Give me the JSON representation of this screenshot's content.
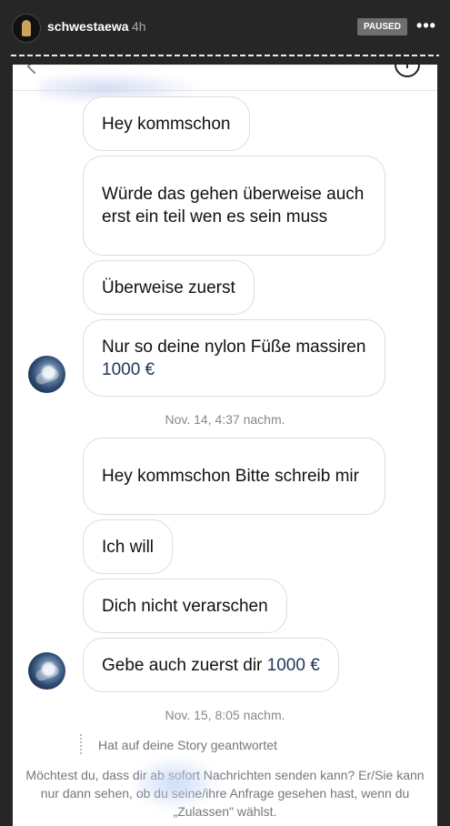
{
  "header": {
    "username": "schwestaewa",
    "time_ago": "4h",
    "paused_label": "PAUSED",
    "more_icon": "more-dots-icon"
  },
  "chat": {
    "messages": [
      {
        "text": "Hey kommschon"
      },
      {
        "text": "Würde das gehen überweise auch erst ein teil wen es sein muss"
      },
      {
        "text": "Überweise zuerst"
      },
      {
        "text_before": "Nur so deine nylon  Füße massiren ",
        "amount": "1000 €"
      },
      {
        "text": "Hey kommschon  Bitte schreib mir"
      },
      {
        "text": "Ich will"
      },
      {
        "text": "Dich nicht verarschen"
      },
      {
        "text_before": "Gebe auch zuerst dir ",
        "amount": "1000 €"
      }
    ],
    "timestamps": [
      "Nov. 14, 4:37 nachm.",
      "Nov. 15, 8:05 nachm."
    ],
    "story_reply": "Hat auf deine Story geantwortet",
    "request_notice": "Möchtest du, dass dir ab sofort Nachrichten senden kann? Er/Sie kann nur dann sehen, ob du seine/ihre Anfrage gesehen hast, wenn du „Zulassen\" wählst."
  },
  "colors": {
    "background": "#262626",
    "amount_color": "#21385e",
    "timestamp_color": "#888888"
  }
}
